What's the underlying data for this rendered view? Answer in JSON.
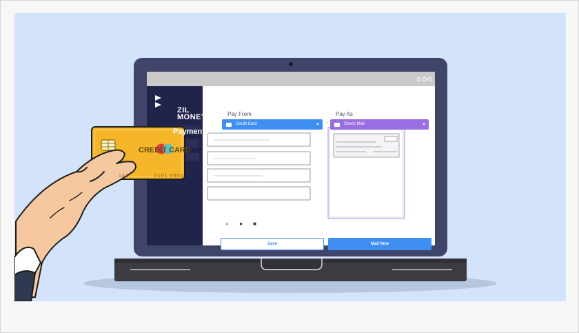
{
  "brand": {
    "line1": "ZIL",
    "line2": "MONEY"
  },
  "sidebar": {
    "items": [
      {
        "label": "Payments"
      }
    ]
  },
  "form": {
    "pay_from_label": "Pay From",
    "pay_from_value": "Credit Card",
    "pay_as_label": "Pay As",
    "pay_as_value": "Check Mail",
    "save_label": "Save",
    "mail_now_label": "Mail Now"
  },
  "card": {
    "title": "CREDIT CARD",
    "number_start": "123",
    "number_end": "0101 0000"
  },
  "icons": [
    "camera-icon",
    "window-dots-icon",
    "brand-logo-icon",
    "credit-card-icon",
    "check-mail-icon",
    "arrow-right-icon",
    "chevron-down-icon",
    "paperclip-icon",
    "comment-icon",
    "calculator-icon",
    "chip-icon",
    "mastercard-icon",
    "hand-icon"
  ],
  "colors": {
    "background": "#d3e3fb",
    "laptop_frame": "#3e4568",
    "sidebar": "#21244a",
    "primary": "#3f8ef1",
    "accent_purple": "#9a6de2",
    "card_gold": "#f5b62a"
  }
}
